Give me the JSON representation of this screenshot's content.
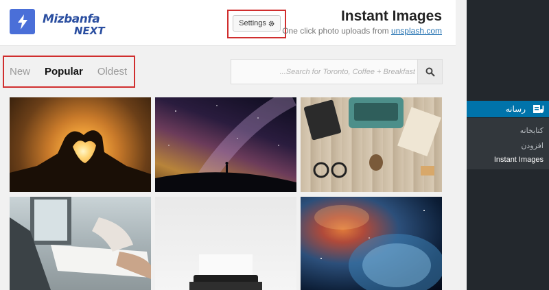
{
  "header": {
    "logo_top": "Mizbanfa",
    "logo_bottom": "NEXT",
    "settings_label": "Settings",
    "title": "Instant Images",
    "subtitle_prefix": "One click photo uploads from ",
    "subtitle_link": "unsplash.com"
  },
  "tabs": [
    {
      "label": "New"
    },
    {
      "label": "Popular"
    },
    {
      "label": "Oldest"
    }
  ],
  "search": {
    "placeholder": "Search for Toronto, Coffee + Breakfast..."
  },
  "sidebar": {
    "media_label": "رسانه",
    "submenu": [
      {
        "label": "کتابخانه"
      },
      {
        "label": "افزودن"
      },
      {
        "label": "Instant Images"
      }
    ]
  },
  "photos": [
    {
      "name": "heart-hands-sunset"
    },
    {
      "name": "milky-way-silhouette"
    },
    {
      "name": "typewriter-desk"
    },
    {
      "name": "laptop-paperwork"
    },
    {
      "name": "typewriter-white"
    },
    {
      "name": "nebula-space"
    }
  ],
  "colors": {
    "accent": "#0073aa",
    "highlight_box": "#d02e2e",
    "app_icon": "#4a6fd8",
    "sidebar": "#23282d"
  }
}
